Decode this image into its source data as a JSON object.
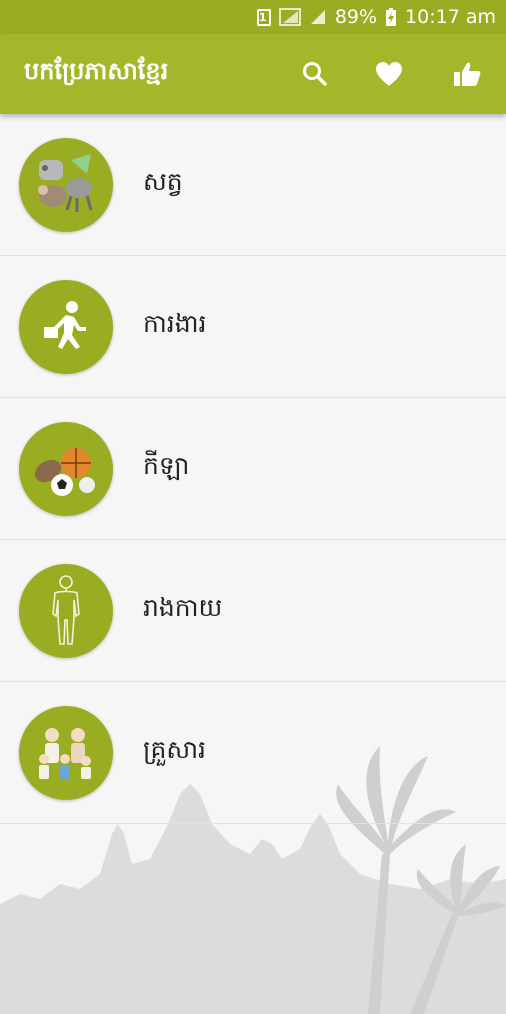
{
  "status_bar": {
    "sim": "1",
    "battery": "89%",
    "time": "10:17 am"
  },
  "app_bar": {
    "title": "បកប្រែភាសាខ្មែរ",
    "icons": [
      "search-icon",
      "heart-icon",
      "thumbs-up-icon"
    ]
  },
  "categories": [
    {
      "label": "សត្វ",
      "icon": "animals-icon"
    },
    {
      "label": "ការងារ",
      "icon": "work-icon"
    },
    {
      "label": "កីឡា",
      "icon": "sports-icon"
    },
    {
      "label": "រាងកាយ",
      "icon": "body-icon"
    },
    {
      "label": "គ្រួសារ",
      "icon": "family-icon"
    }
  ],
  "colors": {
    "primary": "#a4b62a",
    "status_bar": "#9aac21",
    "avatar": "#9aac21",
    "background": "#f6f6f6"
  }
}
